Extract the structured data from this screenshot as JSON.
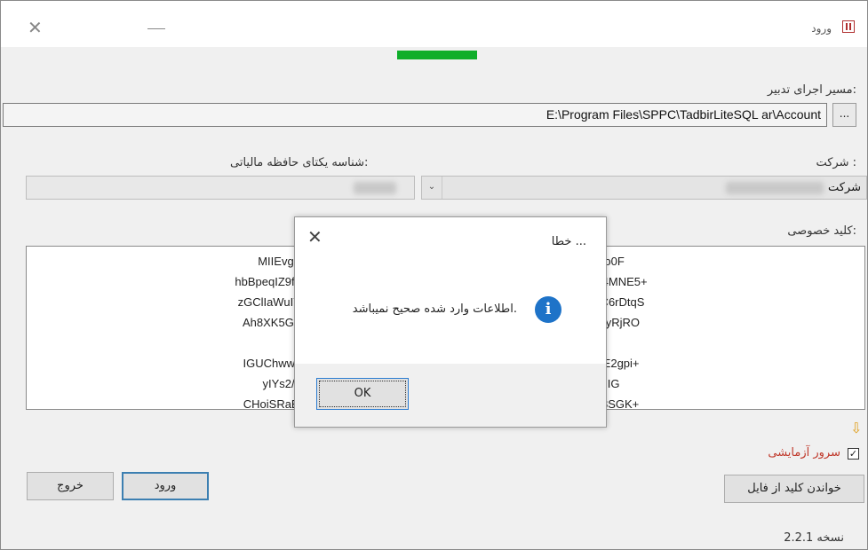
{
  "window": {
    "title": "ورود",
    "icon": "app-logo-icon",
    "close_icon": "close-icon",
    "minimize_icon": "minimize-icon"
  },
  "progress": {
    "fill_fraction": 1.0,
    "color": "#0fae2a"
  },
  "form": {
    "path_label": "مسیر اجرای تدبیر:",
    "path_value": "E:\\Program Files\\SPPC\\TadbirLiteSQL ar\\Account",
    "browse_label": "...",
    "company_label": "شرکت :",
    "company_value": "شرکت",
    "tax_id_label": "شناسه یکتای حافظه مالیاتی:",
    "private_key_label": "کلید خصوصی:",
    "private_key_lines": [
      "MIIEvgIBADANBgkqhkiG9w0BAQ                                                    9T5marnhmdrCaf7L60qdtWmtfbIo0F",
      "hbBpeqIZ9fH5RBvMHRX7i/EGVfuLiiEfZy                                                   pJgM88aiMikywpcRSl4Jr2wD4MNE5+",
      "zGClIaWuIY8SAREA7WjKZY28MaHJb1                                                  553P1kbQkGyAoPDHwB/3u4C6rDtqS",
      "Ah8XK5G4U0F8d1wTA7p0B8QFhnbm                                                  rnrh7rsZhky3DPUSHbfHrSpgInyRjRO",
      "                                                                               CggEAD6e3QnjRdUeh/AQ0Sn4IR7XO",
      "IGUChwwdi2w7kAWIVmEdarVKyD93+                                                  xqzYIOrU6BIbgVg19gjvUqCYrE2gpi+",
      "yIYs2/hAnUOGJkOKSWsSpG                                                  5MEdIVjZn7HzcOteSVGz+kzcNthImIG",
      "CHoiSRaBm5zBnIODHOu7w89/15S1x                                                  sIPi4eVWlnddndef4Y4Y5d/8hf8SGK+"
    ],
    "test_server_label": "سرور آزمایشی",
    "test_server_checked": true,
    "arrow_icon": "down-arrow-icon",
    "read_key_button": "خواندن کلید از فایل",
    "login_button": "ورود",
    "exit_button": "خروج"
  },
  "status": {
    "version": "نسخه 2.2.1"
  },
  "dialog": {
    "title": "خطا ...",
    "message": "اطلاعات وارد شده صحیح نمیباشد.",
    "icon": "info-icon",
    "ok_button": "OK"
  },
  "colors": {
    "accent": "#1e73c8",
    "warning_text": "#c0392b"
  }
}
